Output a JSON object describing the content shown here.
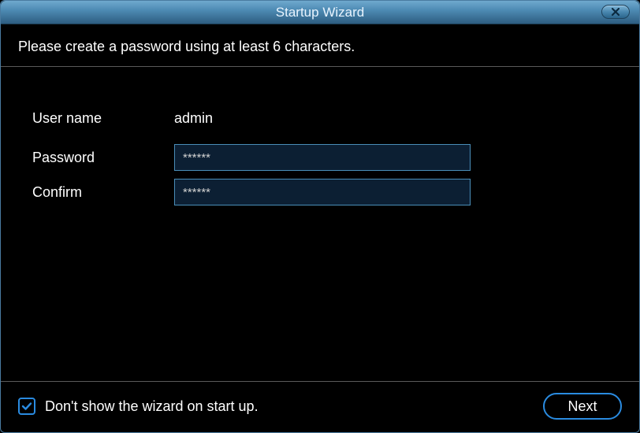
{
  "titlebar": {
    "title": "Startup Wizard"
  },
  "instruction": "Please create a password using at least 6 characters.",
  "form": {
    "username_label": "User name",
    "username_value": "admin",
    "password_label": "Password",
    "password_value": "******",
    "confirm_label": "Confirm",
    "confirm_value": "******"
  },
  "footer": {
    "checkbox_label": "Don't show the wizard on start up.",
    "checkbox_checked": true,
    "next_label": "Next"
  }
}
